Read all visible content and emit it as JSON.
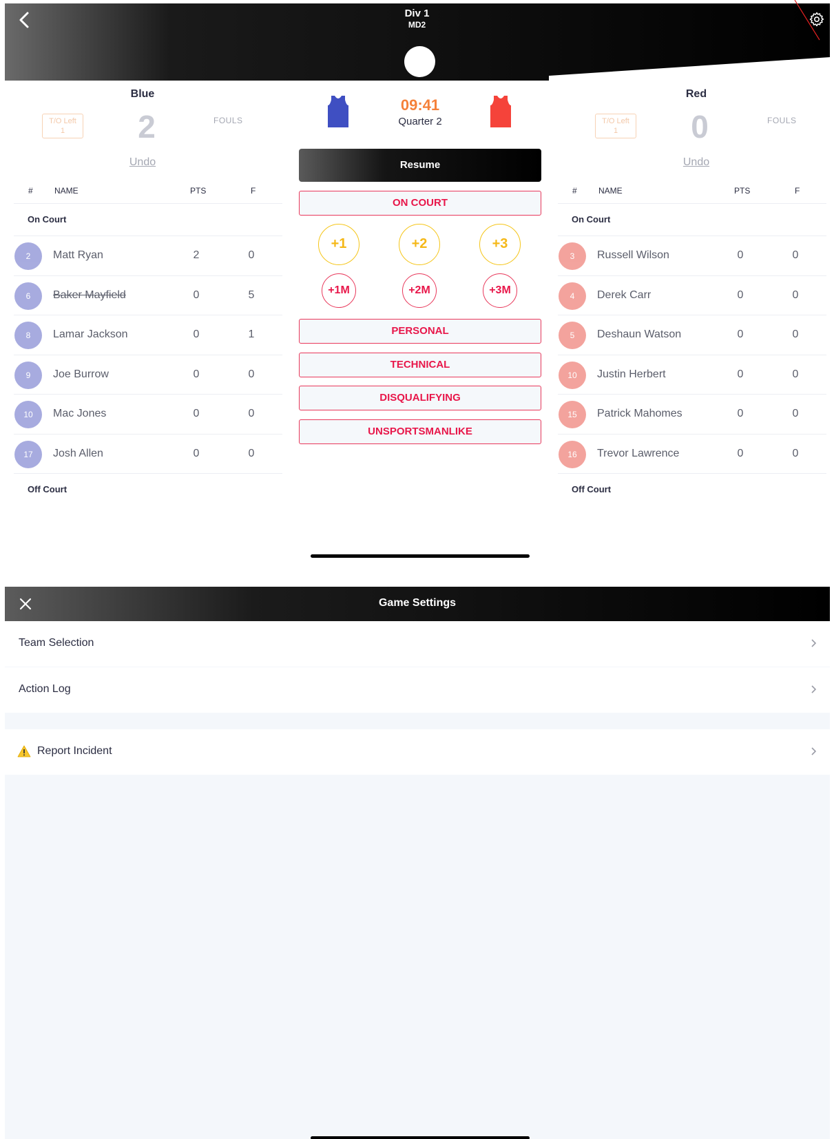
{
  "header": {
    "title": "Div 1",
    "subtitle": "MD2"
  },
  "scoreboard": {
    "clock": "09:41",
    "period": "Quarter 2",
    "resume_label": "Resume",
    "home": {
      "name": "Blue",
      "score": "2",
      "timeouts_label": "T/O Left",
      "timeouts_value": "1",
      "fouls_label": "FOULS",
      "undo_label": "Undo",
      "color": "#3f4fc2"
    },
    "away": {
      "name": "Red",
      "score": "0",
      "timeouts_label": "T/O Left",
      "timeouts_value": "1",
      "fouls_label": "FOULS",
      "undo_label": "Undo",
      "color": "#f5433a"
    }
  },
  "actions": {
    "on_court": "ON COURT",
    "points": [
      "+1",
      "+2",
      "+3"
    ],
    "misses": [
      "+1M",
      "+2M",
      "+3M"
    ],
    "personal": "PERSONAL",
    "technical": "TECHNICAL",
    "disqualifying": "DISQUALIFYING",
    "unsportsmanlike": "UNSPORTSMANLIKE"
  },
  "roster_columns": {
    "number": "#",
    "name": "NAME",
    "points": "PTS",
    "fouls": "F"
  },
  "roster_sections": {
    "on_court": "On Court",
    "off_court": "Off Court"
  },
  "home_players": [
    {
      "number": "2",
      "name": "Matt Ryan",
      "pts": "2",
      "fouls": "0",
      "fouled_out": false
    },
    {
      "number": "6",
      "name": "Baker Mayfield",
      "pts": "0",
      "fouls": "5",
      "fouled_out": true
    },
    {
      "number": "8",
      "name": "Lamar Jackson",
      "pts": "0",
      "fouls": "1",
      "fouled_out": false
    },
    {
      "number": "9",
      "name": "Joe Burrow",
      "pts": "0",
      "fouls": "0",
      "fouled_out": false
    },
    {
      "number": "10",
      "name": "Mac Jones",
      "pts": "0",
      "fouls": "0",
      "fouled_out": false
    },
    {
      "number": "17",
      "name": "Josh Allen",
      "pts": "0",
      "fouls": "0",
      "fouled_out": false
    }
  ],
  "away_players": [
    {
      "number": "3",
      "name": "Russell Wilson",
      "pts": "0",
      "fouls": "0",
      "fouled_out": false
    },
    {
      "number": "4",
      "name": "Derek Carr",
      "pts": "0",
      "fouls": "0",
      "fouled_out": false
    },
    {
      "number": "5",
      "name": "Deshaun Watson",
      "pts": "0",
      "fouls": "0",
      "fouled_out": false
    },
    {
      "number": "10",
      "name": "Justin Herbert",
      "pts": "0",
      "fouls": "0",
      "fouled_out": false
    },
    {
      "number": "15",
      "name": "Patrick Mahomes",
      "pts": "0",
      "fouls": "0",
      "fouled_out": false
    },
    {
      "number": "16",
      "name": "Trevor Lawrence",
      "pts": "0",
      "fouls": "0",
      "fouled_out": false
    }
  ],
  "player_badge_colors": {
    "home": "#9ea3dc",
    "away": "#f29a93"
  },
  "settings": {
    "title": "Game Settings",
    "items": [
      {
        "label": "Team Selection",
        "icon": "chevron-right-icon"
      },
      {
        "label": "Action Log",
        "icon": "chevron-right-icon"
      },
      {
        "label": "Report Incident",
        "icon": "warning-icon"
      }
    ]
  },
  "icons": {
    "back": "chevron-left-icon",
    "settings": "gear-icon",
    "close": "close-icon"
  }
}
